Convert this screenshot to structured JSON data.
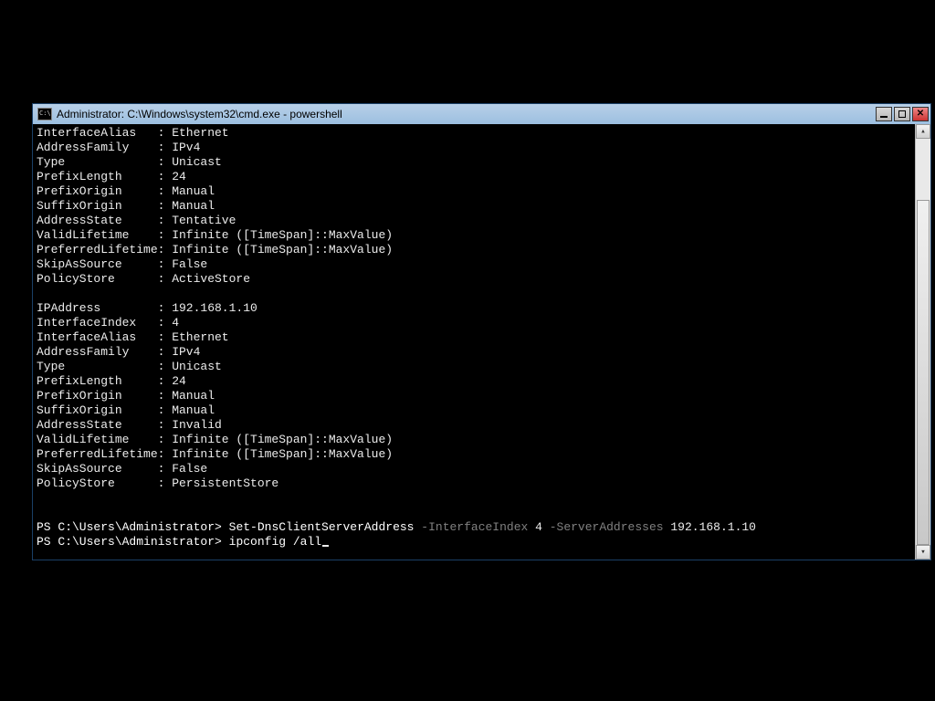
{
  "window": {
    "title": "Administrator: C:\\Windows\\system32\\cmd.exe - powershell"
  },
  "block1": {
    "InterfaceAlias": "Ethernet",
    "AddressFamily": "IPv4",
    "Type": "Unicast",
    "PrefixLength": "24",
    "PrefixOrigin": "Manual",
    "SuffixOrigin": "Manual",
    "AddressState": "Tentative",
    "ValidLifetime": "Infinite ([TimeSpan]::MaxValue)",
    "PreferredLifetime": "Infinite ([TimeSpan]::MaxValue)",
    "SkipAsSource": "False",
    "PolicyStore": "ActiveStore"
  },
  "block2": {
    "IPAddress": "192.168.1.10",
    "InterfaceIndex": "4",
    "InterfaceAlias": "Ethernet",
    "AddressFamily": "IPv4",
    "Type": "Unicast",
    "PrefixLength": "24",
    "PrefixOrigin": "Manual",
    "SuffixOrigin": "Manual",
    "AddressState": "Invalid",
    "ValidLifetime": "Infinite ([TimeSpan]::MaxValue)",
    "PreferredLifetime": "Infinite ([TimeSpan]::MaxValue)",
    "SkipAsSource": "False",
    "PolicyStore": "PersistentStore"
  },
  "prompt1": {
    "ps": "PS C:\\Users\\Administrator> ",
    "cmd": "Set-DnsClientServerAddress",
    "p1": " -InterfaceIndex ",
    "a1": "4",
    "p2": " -ServerAddresses ",
    "a2": "192.168.1.10"
  },
  "prompt2": {
    "ps": "PS C:\\Users\\Administrator> ",
    "cmd": "ipconfig /all"
  },
  "labels": {
    "InterfaceAlias": "InterfaceAlias",
    "AddressFamily": "AddressFamily",
    "Type": "Type",
    "PrefixLength": "PrefixLength",
    "PrefixOrigin": "PrefixOrigin",
    "SuffixOrigin": "SuffixOrigin",
    "AddressState": "AddressState",
    "ValidLifetime": "ValidLifetime",
    "PreferredLifetime": "PreferredLifetime",
    "SkipAsSource": "SkipAsSource",
    "PolicyStore": "PolicyStore",
    "IPAddress": "IPAddress",
    "InterfaceIndex": "InterfaceIndex"
  }
}
